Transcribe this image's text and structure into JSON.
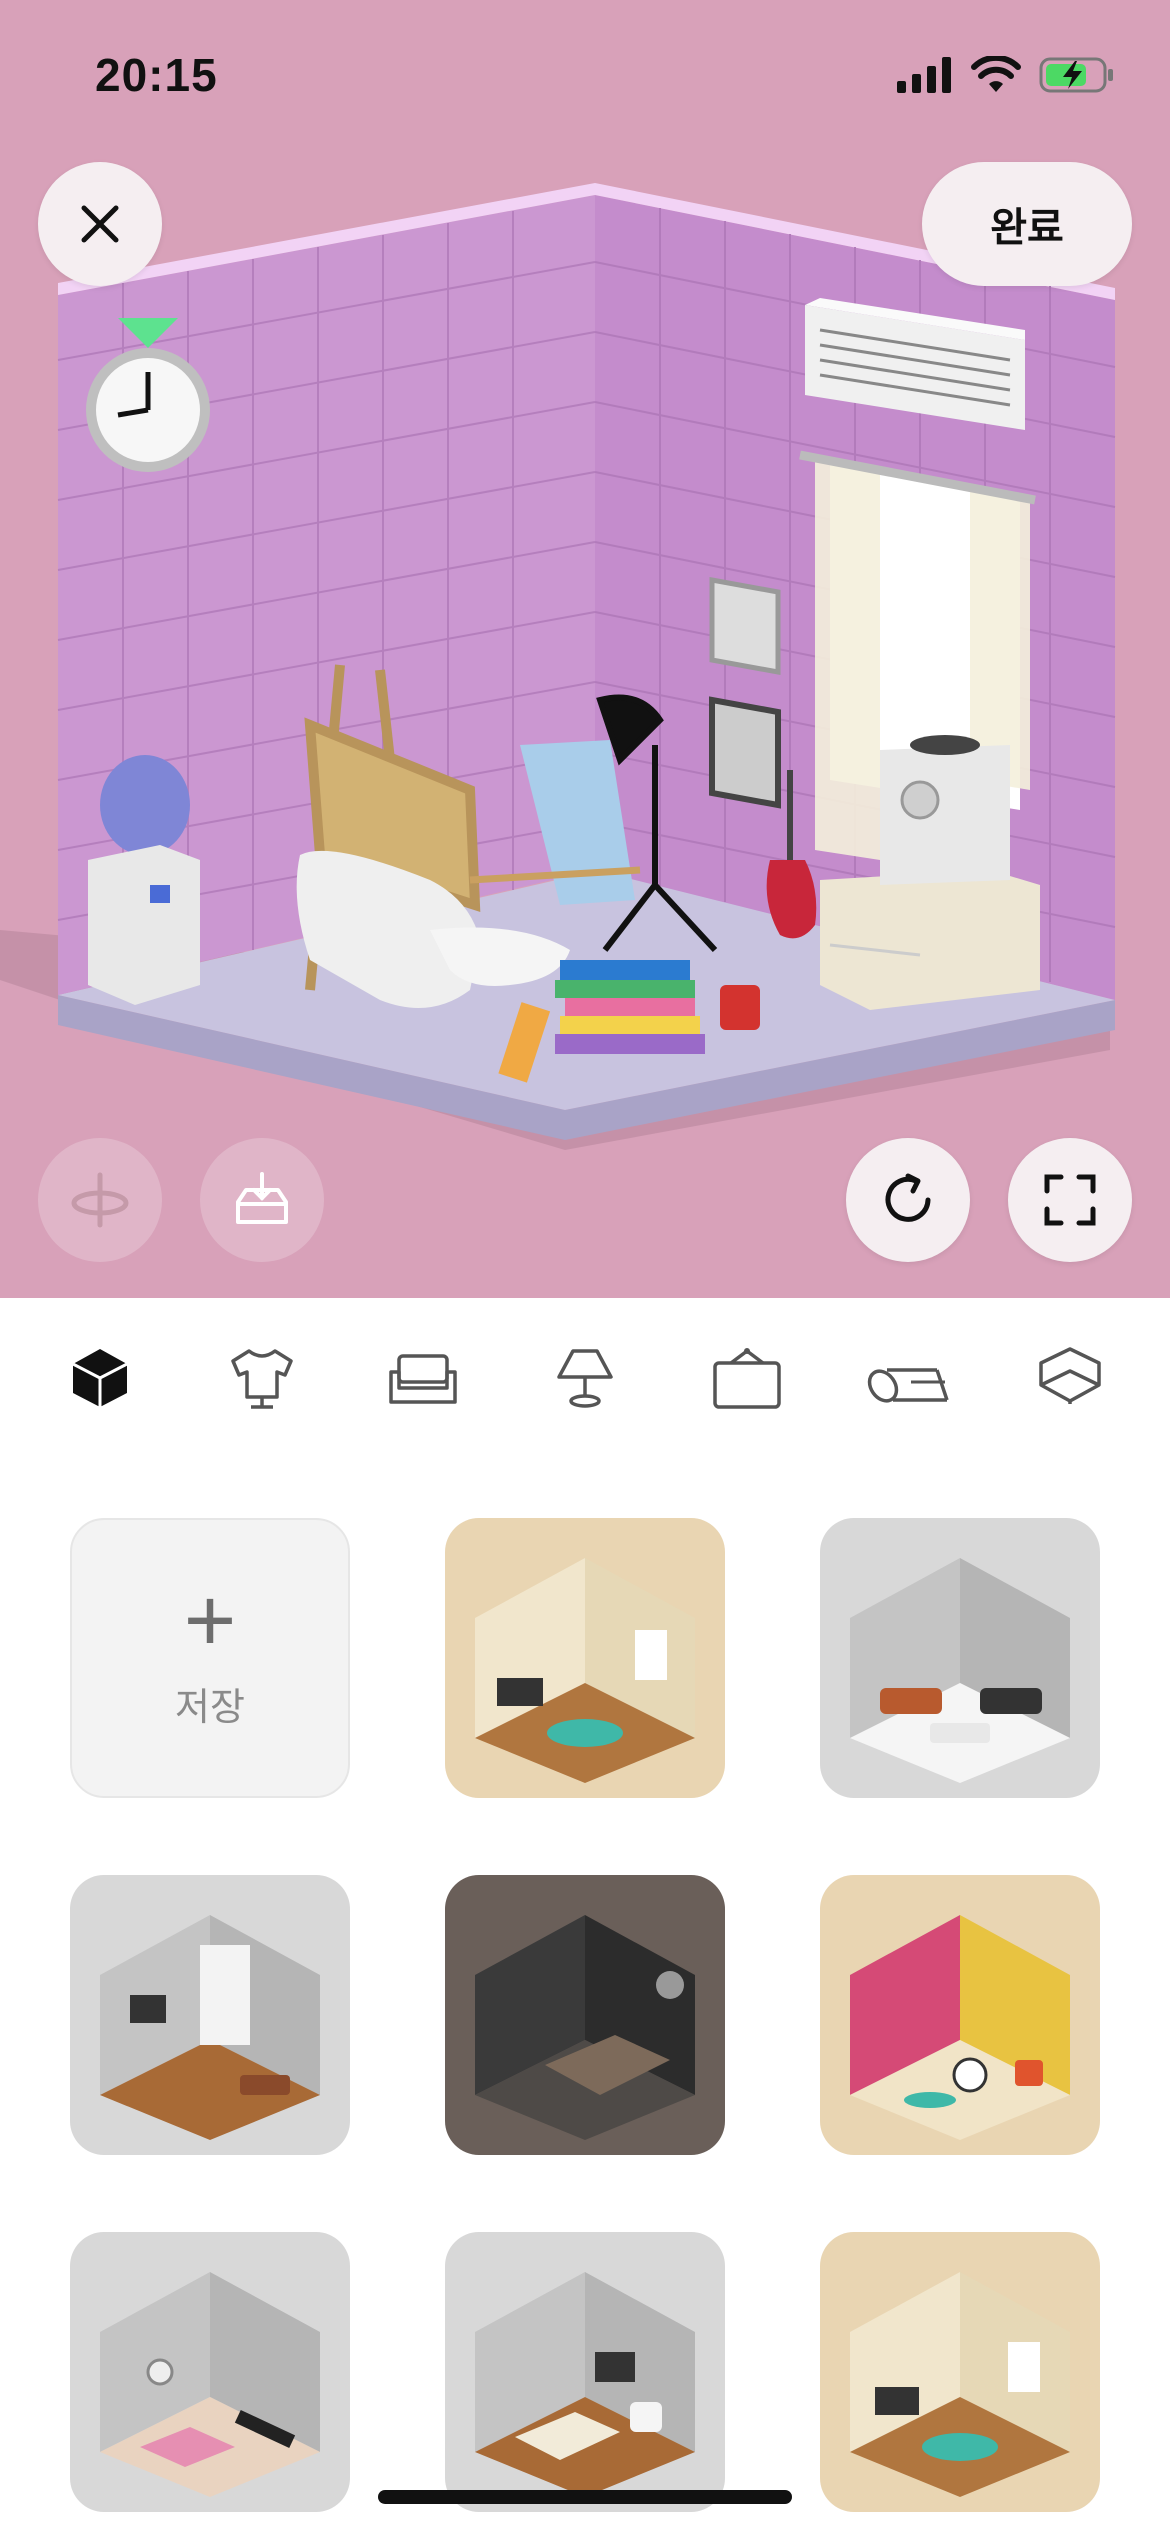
{
  "status_bar": {
    "time": "20:15"
  },
  "header": {
    "done_label": "완료"
  },
  "tabs": [
    {
      "icon": "cube-icon",
      "active": true
    },
    {
      "icon": "shirt-icon",
      "active": false
    },
    {
      "icon": "sofa-icon",
      "active": false
    },
    {
      "icon": "lamp-icon",
      "active": false
    },
    {
      "icon": "frame-icon",
      "active": false
    },
    {
      "icon": "rug-roll-icon",
      "active": false
    },
    {
      "icon": "floor-box-icon",
      "active": false
    }
  ],
  "save_tile": {
    "label": "저장"
  },
  "room_presets": [
    {
      "bg": "#e9d5b2",
      "theme": "beige-living"
    },
    {
      "bg": "#d8d8d8",
      "theme": "grey-lounge"
    },
    {
      "bg": "#d8d8d8",
      "theme": "office"
    },
    {
      "bg": "#6a5f59",
      "theme": "dark-bedroom"
    },
    {
      "bg": "#e9d5b2",
      "theme": "music-room"
    },
    {
      "bg": "#d8d8d8",
      "theme": "gym"
    },
    {
      "bg": "#d8d8d8",
      "theme": "grey-bedroom"
    },
    {
      "bg": "#e9d5b2",
      "theme": "beige-living-2"
    }
  ],
  "colors": {
    "room_bg": "#d8a1b9",
    "wall": "#cb97d1",
    "floor": "#c8c3df",
    "icon_dark": "#111111"
  }
}
